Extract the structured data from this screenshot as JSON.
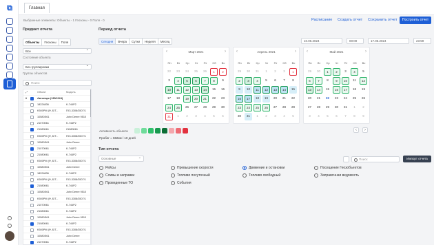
{
  "topbar": {
    "tab": "Главная"
  },
  "info": "Выбранные элементы: Объекты - 1 Геозоны - 0 Поля - 0",
  "actions": {
    "schedule": "Расписание",
    "create": "Создать отчет",
    "save": "Сохранить отчет",
    "build": "Построить отчет"
  },
  "left": {
    "title": "Предмет отчета",
    "tabs": [
      "Объекты",
      "Геозоны",
      "Поля"
    ],
    "all": "Все",
    "state_label": "Состояние объекта",
    "grouping": "Без группировки",
    "group_label": "Группы объектов",
    "search": "Поиск",
    "header_obj": "Объект",
    "header_model": "Модель",
    "root": "Автопарк (135/2024)",
    "rows": [
      {
        "c": false,
        "n": "18224836",
        "m": "K-744P2"
      },
      {
        "c": false,
        "n": "K500PM (Ф, Б/Т...",
        "m": "ГКЗ-3308/3507/1"
      },
      {
        "c": false,
        "n": "10580Э61",
        "m": "John Deere 9510"
      },
      {
        "c": false,
        "n": "21070К61",
        "m": "K-744P2"
      },
      {
        "c": true,
        "n": "21080К61",
        "m": "21080К61"
      },
      {
        "c": false,
        "n": "K500PM (Ф, Б/Т...",
        "m": "ГКЗ-3308/3507/1"
      },
      {
        "c": false,
        "n": "10580Э61",
        "m": "John Deere"
      },
      {
        "c": true,
        "n": "21070К61",
        "m": "K-744P2"
      },
      {
        "c": false,
        "n": "21080К61",
        "m": "K-744P2"
      },
      {
        "c": false,
        "n": "K500PM (Ф, Б/Т...",
        "m": "ГКЗ-3308/3507/1"
      },
      {
        "c": false,
        "n": "10580Э61",
        "m": "John Deere"
      },
      {
        "c": false,
        "n": "18224836",
        "m": "K-744P2"
      },
      {
        "c": false,
        "n": "K500PM (Ф, Б/Т...",
        "m": "ГКЗ-3308/3507/1"
      },
      {
        "c": true,
        "n": "21080К61",
        "m": "K-744P2"
      },
      {
        "c": false,
        "n": "10580Э61",
        "m": "John Deere 9510"
      },
      {
        "c": false,
        "n": "K500PM (Ф, Б/Т...",
        "m": "ГКЗ-3308/3507/1"
      },
      {
        "c": false,
        "n": "21070К61",
        "m": "K-744P2"
      },
      {
        "c": false,
        "n": "21080К61",
        "m": "K-744P2"
      },
      {
        "c": false,
        "n": "10580Э61",
        "m": "John Deere 9510"
      },
      {
        "c": true,
        "n": "21080К61",
        "m": "K-744P2"
      },
      {
        "c": false,
        "n": "K500PM (Ф, Б/Т...",
        "m": "ГКЗ-3308/3507/1"
      },
      {
        "c": false,
        "n": "10580Э61",
        "m": "John Deere"
      },
      {
        "c": true,
        "n": "21070К61",
        "m": "K-744P2"
      }
    ]
  },
  "period": {
    "title": "Период отчета",
    "tabs": [
      "Сегодня",
      "Вчера",
      "Сутки",
      "Неделя",
      "Месяц"
    ],
    "from_date": "10.06.2024",
    "from_time": "00:00",
    "to_date": "17.06.2024",
    "to_time": "23:59"
  },
  "calendars": [
    {
      "title": "Март 2021",
      "days": [
        {
          "n": "22",
          "o": 1
        },
        {
          "n": "23",
          "o": 1
        },
        {
          "n": "24",
          "o": 1
        },
        {
          "n": "25",
          "o": 1
        },
        {
          "n": "26",
          "o": 1
        },
        {
          "n": "1",
          "s": "red"
        },
        {
          "n": "2",
          "s": "red"
        },
        {
          "n": "3"
        },
        {
          "n": "4",
          "s": "g1"
        },
        {
          "n": "5",
          "s": "g2"
        },
        {
          "n": "6",
          "s": "g2"
        },
        {
          "n": "7",
          "s": "g1"
        },
        {
          "n": "8",
          "s": "g1"
        },
        {
          "n": "9"
        },
        {
          "n": "10",
          "s": "g2"
        },
        {
          "n": "11",
          "s": "g1"
        },
        {
          "n": "12",
          "s": "g1"
        },
        {
          "n": "13",
          "s": "g1"
        },
        {
          "n": "14",
          "s": "g2"
        },
        {
          "n": "15"
        },
        {
          "n": "16"
        },
        {
          "n": "17"
        },
        {
          "n": "18"
        },
        {
          "n": "19",
          "s": "g1"
        },
        {
          "n": "20",
          "s": "g1"
        },
        {
          "n": "21",
          "s": "g1"
        },
        {
          "n": "22"
        },
        {
          "n": "23"
        },
        {
          "n": "24",
          "s": "g1"
        },
        {
          "n": "25",
          "s": "g1"
        },
        {
          "n": "26"
        },
        {
          "n": "27"
        },
        {
          "n": "28"
        },
        {
          "n": "29"
        },
        {
          "n": "30"
        },
        {
          "n": "31",
          "s": "red"
        },
        {
          "n": "1",
          "o": 1
        },
        {
          "n": "2",
          "o": 1
        },
        {
          "n": "3",
          "o": 1
        },
        {
          "n": "4",
          "o": 1
        },
        {
          "n": "5",
          "o": 1
        },
        {
          "n": "6",
          "o": 1
        }
      ]
    },
    {
      "title": "Апрель 2021",
      "days": [
        {
          "n": "29",
          "o": 1
        },
        {
          "n": "30",
          "o": 1
        },
        {
          "n": "31",
          "o": 1
        },
        {
          "n": "1",
          "o": 1
        },
        {
          "n": "2",
          "o": 1
        },
        {
          "n": "3",
          "o": 1
        },
        {
          "n": "1",
          "s": "red"
        },
        {
          "n": "2",
          "s": "g1"
        },
        {
          "n": "3",
          "s": "g2"
        },
        {
          "n": "4",
          "s": "g1"
        },
        {
          "n": "5"
        },
        {
          "n": "6"
        },
        {
          "n": "7"
        },
        {
          "n": "8"
        },
        {
          "n": "9",
          "s": "b"
        },
        {
          "n": "10",
          "s": "b"
        },
        {
          "n": "11",
          "s": "bb"
        },
        {
          "n": "12",
          "s": "bb"
        },
        {
          "n": "13",
          "s": "bb"
        },
        {
          "n": "14",
          "s": "bb"
        },
        {
          "n": "15",
          "s": "b"
        },
        {
          "n": "16",
          "s": "bb"
        },
        {
          "n": "17",
          "s": "bb"
        },
        {
          "n": "18",
          "s": "b"
        },
        {
          "n": "19",
          "s": "b"
        },
        {
          "n": "20"
        },
        {
          "n": "21"
        },
        {
          "n": "22"
        },
        {
          "n": "23",
          "s": "g1"
        },
        {
          "n": "24",
          "s": "g1"
        },
        {
          "n": "25",
          "s": "g1"
        },
        {
          "n": "26",
          "s": "g1"
        },
        {
          "n": "27"
        },
        {
          "n": "28"
        },
        {
          "n": "29"
        },
        {
          "n": "30"
        },
        {
          "n": "31",
          "s": "b"
        },
        {
          "n": "1",
          "o": 1
        },
        {
          "n": "2",
          "o": 1
        },
        {
          "n": "3",
          "o": 1
        },
        {
          "n": "4",
          "o": 1
        },
        {
          "n": "5",
          "o": 1
        }
      ]
    },
    {
      "title": "Май 2021",
      "days": [
        {
          "n": "29",
          "o": 1
        },
        {
          "n": "30",
          "o": 1
        },
        {
          "n": "1",
          "s": "g1"
        },
        {
          "n": "2",
          "s": "g1"
        },
        {
          "n": "3"
        },
        {
          "n": "4",
          "s": "g1"
        },
        {
          "n": "5"
        },
        {
          "n": "6",
          "s": "g1"
        },
        {
          "n": "7",
          "s": "g1"
        },
        {
          "n": "8"
        },
        {
          "n": "9",
          "s": "g1"
        },
        {
          "n": "10",
          "s": "g1"
        },
        {
          "n": "11"
        },
        {
          "n": "12",
          "s": "g1"
        },
        {
          "n": "13",
          "s": "g2"
        },
        {
          "n": "14",
          "s": "g1"
        },
        {
          "n": "15"
        },
        {
          "n": "16",
          "s": "g1"
        },
        {
          "n": "17",
          "s": "g1"
        },
        {
          "n": "18"
        },
        {
          "n": "19"
        },
        {
          "n": "20"
        },
        {
          "n": "21"
        },
        {
          "n": "22",
          "s": "dot"
        },
        {
          "n": "23"
        },
        {
          "n": "24"
        },
        {
          "n": "25"
        },
        {
          "n": "26"
        },
        {
          "n": "27"
        },
        {
          "n": "28"
        },
        {
          "n": "29"
        },
        {
          "n": "30"
        },
        {
          "n": "31"
        },
        {
          "n": "1",
          "o": 1
        },
        {
          "n": "2",
          "o": 1
        },
        {
          "n": "3",
          "o": 1
        },
        {
          "n": "4",
          "o": 1
        },
        {
          "n": "5",
          "o": 1
        },
        {
          "n": "6",
          "o": 1
        },
        {
          "n": "7",
          "o": 1
        },
        {
          "n": "8",
          "o": 1
        },
        {
          "n": "9",
          "o": 1
        }
      ]
    }
  ],
  "weekdays": [
    "Пн",
    "Вт",
    "Ср",
    "Чт",
    "Пт",
    "Сб",
    "Вс"
  ],
  "activity": {
    "label": "Активность объекта",
    "colors": [
      "#c9f0d9",
      "#6fdc9b",
      "#2fc06b",
      "#179a4f",
      "#0c6e36",
      "#f4a7ad",
      "#ee6b74",
      "#e2323f"
    ]
  },
  "mileage": "Пробег = 682км / 10 дней",
  "report": {
    "title": "Тип отчета",
    "select": "Основные",
    "search": "Поиск",
    "export": "Импорт отчета",
    "options": [
      "Рейсы",
      "Превышение скорости",
      "Движение и остановки",
      "Посещение Геозобъектов",
      "Сливы и заправки",
      "Топливо посуточный",
      "Топливо свободный",
      "Заправочная ведомость",
      "Проведенные ТО",
      "События"
    ]
  }
}
